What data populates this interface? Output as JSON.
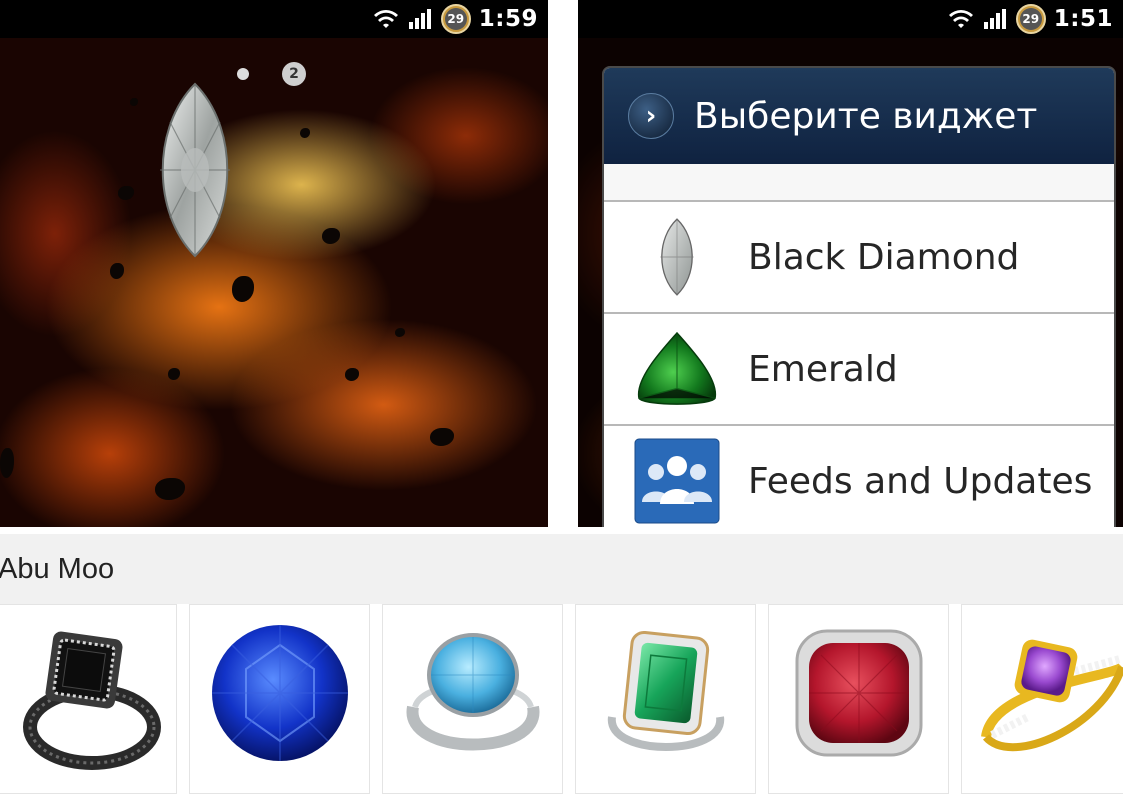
{
  "left_screenshot": {
    "status_time": "1:59",
    "battery_level": "29",
    "page_indicator": "2"
  },
  "right_screenshot": {
    "status_time": "1:51",
    "battery_level": "29",
    "dialog": {
      "title": "Выберите виджет",
      "items": [
        {
          "label": "Black Diamond",
          "icon": "black-diamond-icon"
        },
        {
          "label": "Emerald",
          "icon": "emerald-icon"
        },
        {
          "label": "Feeds and Updates",
          "icon": "feeds-updates-icon"
        }
      ]
    }
  },
  "developer": {
    "name": "Abu Moo"
  },
  "related_apps": [
    {
      "icon": "black-diamond-ring-icon",
      "accent": "#1a1a1a"
    },
    {
      "icon": "blue-sapphire-icon",
      "accent": "#1a3fd8"
    },
    {
      "icon": "aquamarine-ring-icon",
      "accent": "#5ab8e0"
    },
    {
      "icon": "emerald-ring-icon",
      "accent": "#1a9a5a"
    },
    {
      "icon": "ruby-ring-icon",
      "accent": "#c0203a"
    },
    {
      "icon": "amethyst-ring-icon",
      "accent": "#a050c8"
    }
  ],
  "colors": {
    "dialog_header": "#1f3a5a",
    "developer_bar": "#f1f1f1"
  }
}
